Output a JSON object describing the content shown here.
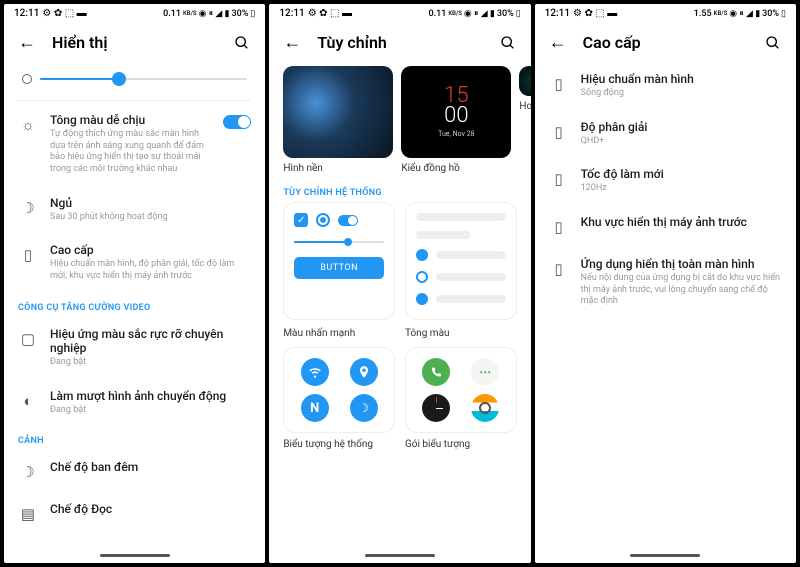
{
  "status": {
    "time": "12:11",
    "net_speed1": "0.11",
    "net_speed2": "1.55",
    "net_unit": "KB/S",
    "battery": "30%"
  },
  "screen1": {
    "title": "Hiển thị",
    "slider_value": 38,
    "comfort": {
      "title": "Tông màu dễ chịu",
      "sub": "Tự động thích ứng màu sắc màn hình dựa trên ánh sáng xung quanh để đảm bảo hiệu ứng hiển thị tạo sự thoải mái trong các môi trường khác nhau"
    },
    "sleep": {
      "title": "Ngủ",
      "sub": "Sau 30 phút không hoạt động"
    },
    "advanced": {
      "title": "Cao cấp",
      "sub": "Hiệu chuẩn màn hình, độ phân giải, tốc độ làm mới, khu vực hiển thị máy ảnh trước"
    },
    "section_video": "CÔNG CỤ TĂNG CƯỜNG VIDEO",
    "vivid": {
      "title": "Hiệu ứng màu sắc rực rỡ chuyên nghiệp",
      "sub": "Đang bật"
    },
    "smooth": {
      "title": "Làm mượt hình ảnh chuyển động",
      "sub": "Đang bật"
    },
    "section_scene": "CẢNH",
    "night": {
      "title": "Chế độ ban đêm"
    },
    "read": {
      "title": "Chế độ Đọc"
    }
  },
  "screen2": {
    "title": "Tùy chỉnh",
    "clock_h": "15",
    "clock_m": "00",
    "clock_date": "Tue, Nov 28",
    "thumb1": "Hình nền",
    "thumb2": "Kiểu đồng hồ",
    "thumb3": "Hoạt ả",
    "section": "TÙY CHỈNH HỆ THỐNG",
    "button": "BUTTON",
    "accent": "Màu nhấn mạnh",
    "tone": "Tông màu",
    "sys_icons": "Biểu tượng hệ thống",
    "icon_pack": "Gói biểu tượng"
  },
  "screen3": {
    "title": "Cao cấp",
    "calib": {
      "title": "Hiệu chuẩn màn hình",
      "sub": "Sống động"
    },
    "res": {
      "title": "Độ phân giải",
      "sub": "QHD+"
    },
    "refresh": {
      "title": "Tốc độ làm mới",
      "sub": "120Hz"
    },
    "camera": {
      "title": "Khu vực hiển thị máy ảnh trước"
    },
    "fullscreen": {
      "title": "Ứng dụng hiển thị toàn màn hình",
      "sub": "Nếu nội dung của ứng dụng bị cắt do khu vực hiển thị máy ảnh trước, vui lòng chuyển sang chế độ mặc định"
    }
  }
}
